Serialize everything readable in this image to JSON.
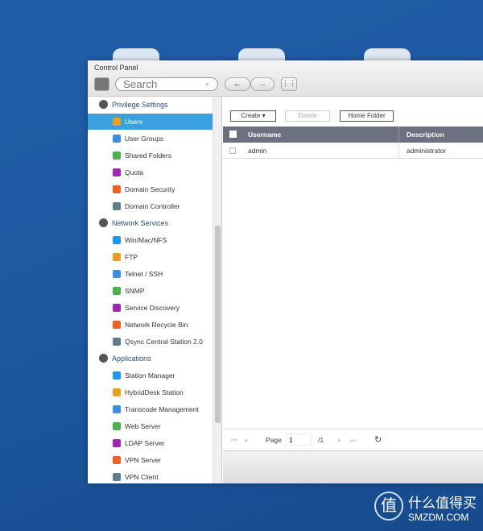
{
  "window": {
    "title": "Control Panel"
  },
  "toolbar": {
    "search_placeholder": "Search"
  },
  "sidebar": {
    "groups": [
      {
        "label": "Privilege Settings",
        "items": [
          "Users",
          "User Groups",
          "Shared Folders",
          "Quota",
          "Domain Security",
          "Domain Controller"
        ]
      },
      {
        "label": "Network Services",
        "items": [
          "Win/Mac/NFS",
          "FTP",
          "Telnet / SSH",
          "SNMP",
          "Service Discovery",
          "Network Recycle Bin",
          "Qsync Central Station 2.0"
        ]
      },
      {
        "label": "Applications",
        "items": [
          "Station Manager",
          "HybridDesk Station",
          "Transcode Management",
          "Web Server",
          "LDAP Server",
          "VPN Server",
          "VPN Client"
        ]
      }
    ],
    "selected": "Users"
  },
  "actions": {
    "create": "Create ▾",
    "delete": "Delete",
    "home_folder": "Home Folder"
  },
  "table": {
    "columns": [
      "Username",
      "Description"
    ],
    "rows": [
      {
        "username": "admin",
        "description": "administrator"
      }
    ]
  },
  "pager": {
    "label": "Page",
    "page": "1",
    "total": "/1"
  },
  "watermark": {
    "logo_char": "值",
    "cn": "什么值得买",
    "en": "SMZDM.COM"
  },
  "colors": {
    "selected": "#3aa0e0",
    "header": "#6b7180"
  }
}
